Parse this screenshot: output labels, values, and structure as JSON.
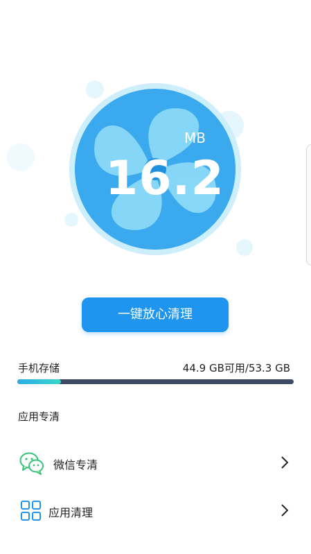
{
  "scan": {
    "size_value": "16.2",
    "size_unit": "MB"
  },
  "actions": {
    "clean_button_label": "一键放心清理"
  },
  "storage": {
    "label": "手机存储",
    "value_text": "44.9 GB可用/53.3 GB",
    "used_fraction": 0.158
  },
  "apps_section": {
    "title": "应用专清",
    "items": [
      {
        "label": "微信专清",
        "icon": "wechat-icon"
      },
      {
        "label": "应用清理",
        "icon": "grid-apps-icon"
      }
    ]
  },
  "colors": {
    "accent_blue": "#1f95f0",
    "fan_blue": "#3aa9ee",
    "wechat_green": "#37c37a",
    "bar_track": "#3c4a66",
    "bar_fill_start": "#2fa9e8",
    "bar_fill_end": "#37d8c8"
  }
}
